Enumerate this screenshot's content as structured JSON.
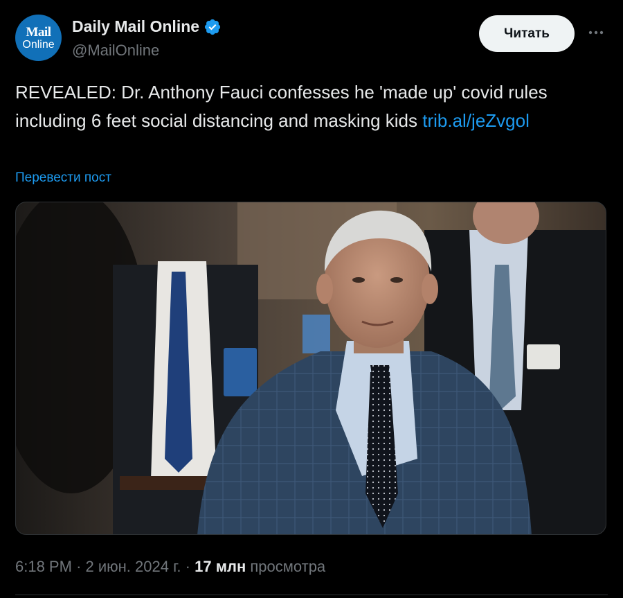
{
  "author": {
    "avatar_top": "Mail",
    "avatar_bottom": "Online",
    "display_name": "Daily Mail Online",
    "handle": "@MailOnline",
    "verified": true
  },
  "follow_button": {
    "label": "Читать"
  },
  "tweet": {
    "text": "REVEALED: Dr. Anthony Fauci confesses he 'made up' covid rules including 6 feet social distancing and masking kids",
    "link_text": "trib.al/jeZvgol",
    "translate_label": "Перевести пост"
  },
  "media": {
    "description": "Photo of a man in a blue plaid suit and dotted tie walking in a hallway, with other suited men in the background"
  },
  "meta": {
    "time": "6:18 PM",
    "separator1": "·",
    "date": "2 июн. 2024 г.",
    "separator2": "·",
    "views_count": "17 млн",
    "views_label": "просмотра"
  },
  "colors": {
    "background": "#000000",
    "text_primary": "#e7e9ea",
    "text_secondary": "#71767b",
    "link": "#1d9bf0",
    "button_bg": "#eff3f4",
    "avatar_bg": "#1170b8"
  },
  "icons": {
    "verified": "verified-badge-icon",
    "more": "more-dots-icon"
  }
}
